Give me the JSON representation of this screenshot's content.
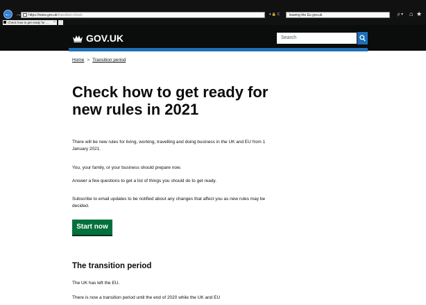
{
  "browser": {
    "url_host": "https://www.gov.uk",
    "url_path": "/transition-check",
    "search_query": "leaving the Eu gov.uk",
    "tab_title": "Check how to get ready for ...",
    "tab_close": "×",
    "addr_controls": "▾ 🔒 C",
    "search_controls": "ρ ▾"
  },
  "header": {
    "logo_text": "GOV.UK",
    "search_placeholder": "Search"
  },
  "breadcrumb": {
    "home": "Home",
    "separator": ">",
    "current": "Transition period"
  },
  "main": {
    "title": "Check how to get ready for new rules in 2021",
    "paragraphs": [
      "There will be new rules for living, working, travelling and doing business in the UK and EU from 1 January 2021.",
      "You, your family, or your business should prepare now.",
      "Answer a few questions to get a list of things you should do to get ready.",
      "Subscribe to email updates to be notified about any changes that affect you as new rules may be decided."
    ],
    "start_button": "Start now"
  },
  "transition": {
    "heading": "The transition period",
    "paragraphs": [
      "The UK has left the EU.",
      "There is now a transition period until the end of 2020 while the UK and EU"
    ]
  },
  "colors": {
    "header_bg": "#0b0c0c",
    "brand_blue": "#1d70b8",
    "start_green": "#00703c",
    "text": "#0b0c0c"
  }
}
